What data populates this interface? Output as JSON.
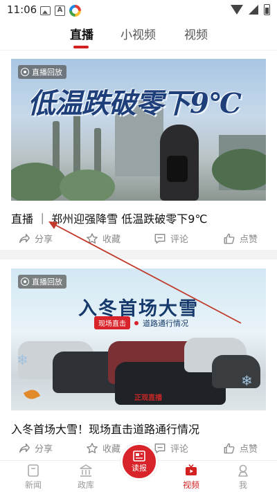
{
  "status_bar": {
    "time": "11:06"
  },
  "top_tabs": [
    {
      "label": "直播",
      "active": true
    },
    {
      "label": "小视频",
      "active": false
    },
    {
      "label": "视频",
      "active": false
    }
  ],
  "cards": [
    {
      "badge": "直播回放",
      "image_headline": "低温跌破零下9℃",
      "title": "直播 ｜ 郑州迎强降雪  低温跌破零下9℃",
      "actions": {
        "share": "分享",
        "favorite": "收藏",
        "comment": "评论",
        "like": "点赞"
      }
    },
    {
      "badge": "直播回放",
      "image_headline": "入冬首场大雪",
      "image_pill": "现场直击",
      "image_subtitle": "道路通行情况",
      "image_watermark": "正观直播",
      "title": "入冬首场大雪！现场直击道路通行情况",
      "actions": {
        "share": "分享",
        "favorite": "收藏",
        "comment": "评论",
        "like": "点赞"
      }
    }
  ],
  "bottom_nav": {
    "items": [
      {
        "label": "新闻",
        "icon": "news-icon",
        "active": false
      },
      {
        "label": "政库",
        "icon": "government-building-icon",
        "active": false
      },
      {
        "label": "视频",
        "icon": "tv-video-icon",
        "active": true
      },
      {
        "label": "我",
        "icon": "person-icon",
        "active": false
      }
    ],
    "center_button": {
      "label": "读报",
      "icon": "newspaper-icon"
    }
  },
  "colors": {
    "accent": "#d32020",
    "annotation_arrow": "#c0392b"
  }
}
